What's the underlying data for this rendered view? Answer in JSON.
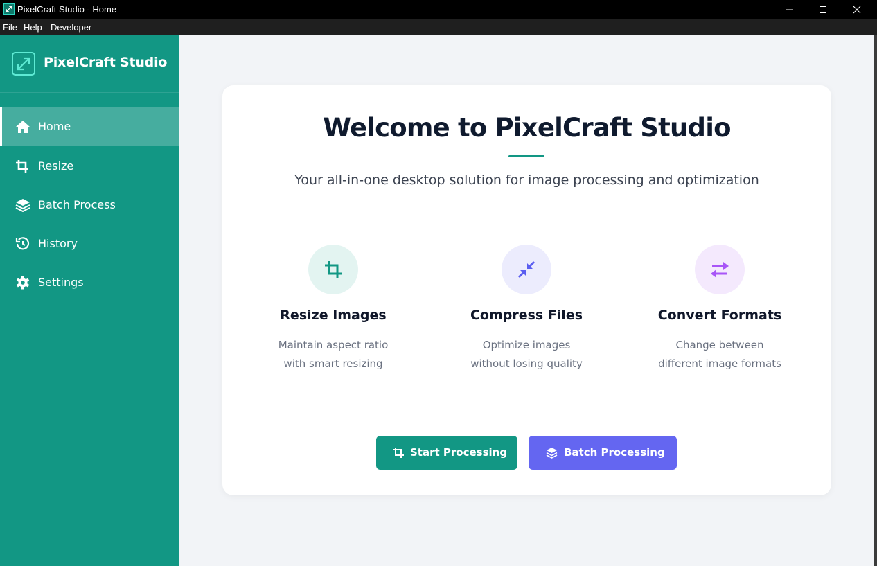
{
  "window": {
    "title": "PixelCraft Studio - Home",
    "controls": [
      "minimize-icon",
      "maximize-icon",
      "close-icon"
    ]
  },
  "menubar": {
    "items": [
      "File",
      "Help",
      "Developer"
    ]
  },
  "sidebar": {
    "brand": "PixelCraft Studio",
    "items": [
      {
        "label": "Home",
        "icon": "home-icon",
        "active": true
      },
      {
        "label": "Resize",
        "icon": "crop-icon",
        "active": false
      },
      {
        "label": "Batch Process",
        "icon": "layers-icon",
        "active": false
      },
      {
        "label": "History",
        "icon": "history-icon",
        "active": false
      },
      {
        "label": "Settings",
        "icon": "gear-icon",
        "active": false
      }
    ]
  },
  "main": {
    "heading": "Welcome to PixelCraft Studio",
    "subtitle": "Your all-in-one desktop solution for image processing and optimization",
    "features": [
      {
        "title": "Resize Images",
        "desc_line1": "Maintain aspect ratio",
        "desc_line2": "with smart resizing",
        "icon": "crop-icon"
      },
      {
        "title": "Compress Files",
        "desc_line1": "Optimize images",
        "desc_line2": "without losing quality",
        "icon": "compress-icon"
      },
      {
        "title": "Convert Formats",
        "desc_line1": "Change between",
        "desc_line2": "different image formats",
        "icon": "exchange-icon"
      }
    ],
    "buttons": {
      "start": "Start Processing",
      "batch": "Batch Processing"
    }
  },
  "colors": {
    "sidebar": "#129784",
    "accent": "#129784",
    "batch_button": "#6466f1",
    "compress_icon": "#5b5ef0",
    "convert_icon": "#a855f7",
    "background": "#f2f4f7"
  }
}
